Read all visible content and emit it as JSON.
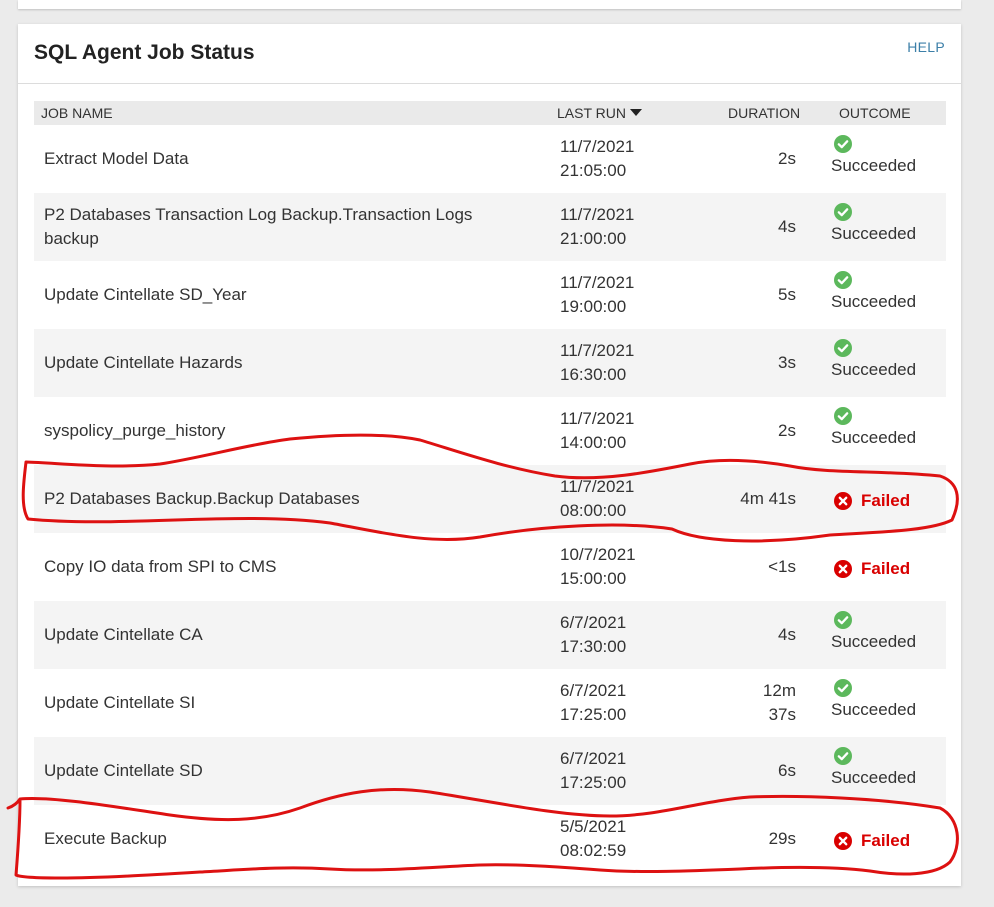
{
  "panel": {
    "title": "SQL Agent Job Status",
    "help": "HELP"
  },
  "table": {
    "headers": {
      "job_name": "JOB NAME",
      "last_run": "LAST RUN",
      "duration": "DURATION",
      "outcome": "OUTCOME"
    },
    "sort": "last-run descending",
    "rows": [
      {
        "name": "Extract Model Data",
        "date": "11/7/2021",
        "time": "21:05:00",
        "duration": [
          "2s"
        ],
        "outcome": "Succeeded",
        "status": "success"
      },
      {
        "name": "P2 Databases Transaction Log Backup.Transaction Logs backup",
        "date": "11/7/2021",
        "time": "21:00:00",
        "duration": [
          "4s"
        ],
        "outcome": "Succeeded",
        "status": "success"
      },
      {
        "name": "Update Cintellate SD_Year",
        "date": "11/7/2021",
        "time": "19:00:00",
        "duration": [
          "5s"
        ],
        "outcome": "Succeeded",
        "status": "success"
      },
      {
        "name": "Update Cintellate Hazards",
        "date": "11/7/2021",
        "time": "16:30:00",
        "duration": [
          "3s"
        ],
        "outcome": "Succeeded",
        "status": "success"
      },
      {
        "name": "syspolicy_purge_history",
        "date": "11/7/2021",
        "time": "14:00:00",
        "duration": [
          "2s"
        ],
        "outcome": "Succeeded",
        "status": "success"
      },
      {
        "name": "P2 Databases Backup.Backup Databases",
        "date": "11/7/2021",
        "time": "08:00:00",
        "duration": [
          "4m 41s"
        ],
        "outcome": "Failed",
        "status": "failed"
      },
      {
        "name": "Copy IO data from SPI to CMS",
        "date": "10/7/2021",
        "time": "15:00:00",
        "duration": [
          "<1s"
        ],
        "outcome": "Failed",
        "status": "failed"
      },
      {
        "name": "Update Cintellate CA",
        "date": "6/7/2021",
        "time": "17:30:00",
        "duration": [
          "4s"
        ],
        "outcome": "Succeeded",
        "status": "success"
      },
      {
        "name": "Update Cintellate SI",
        "date": "6/7/2021",
        "time": "17:25:00",
        "duration": [
          "12m",
          "37s"
        ],
        "outcome": "Succeeded",
        "status": "success"
      },
      {
        "name": "Update Cintellate SD",
        "date": "6/7/2021",
        "time": "17:25:00",
        "duration": [
          "6s"
        ],
        "outcome": "Succeeded",
        "status": "success"
      },
      {
        "name": "Execute Backup",
        "date": "5/5/2021",
        "time": "08:02:59",
        "duration": [
          "29s"
        ],
        "outcome": "Failed",
        "status": "failed"
      }
    ]
  },
  "colors": {
    "success": "#5cb85c",
    "failed": "#d90000",
    "annotation": "#dd1111",
    "help_link": "#3c7fa8"
  },
  "icons": {
    "success": "check-circle-icon",
    "failed": "x-circle-icon"
  }
}
